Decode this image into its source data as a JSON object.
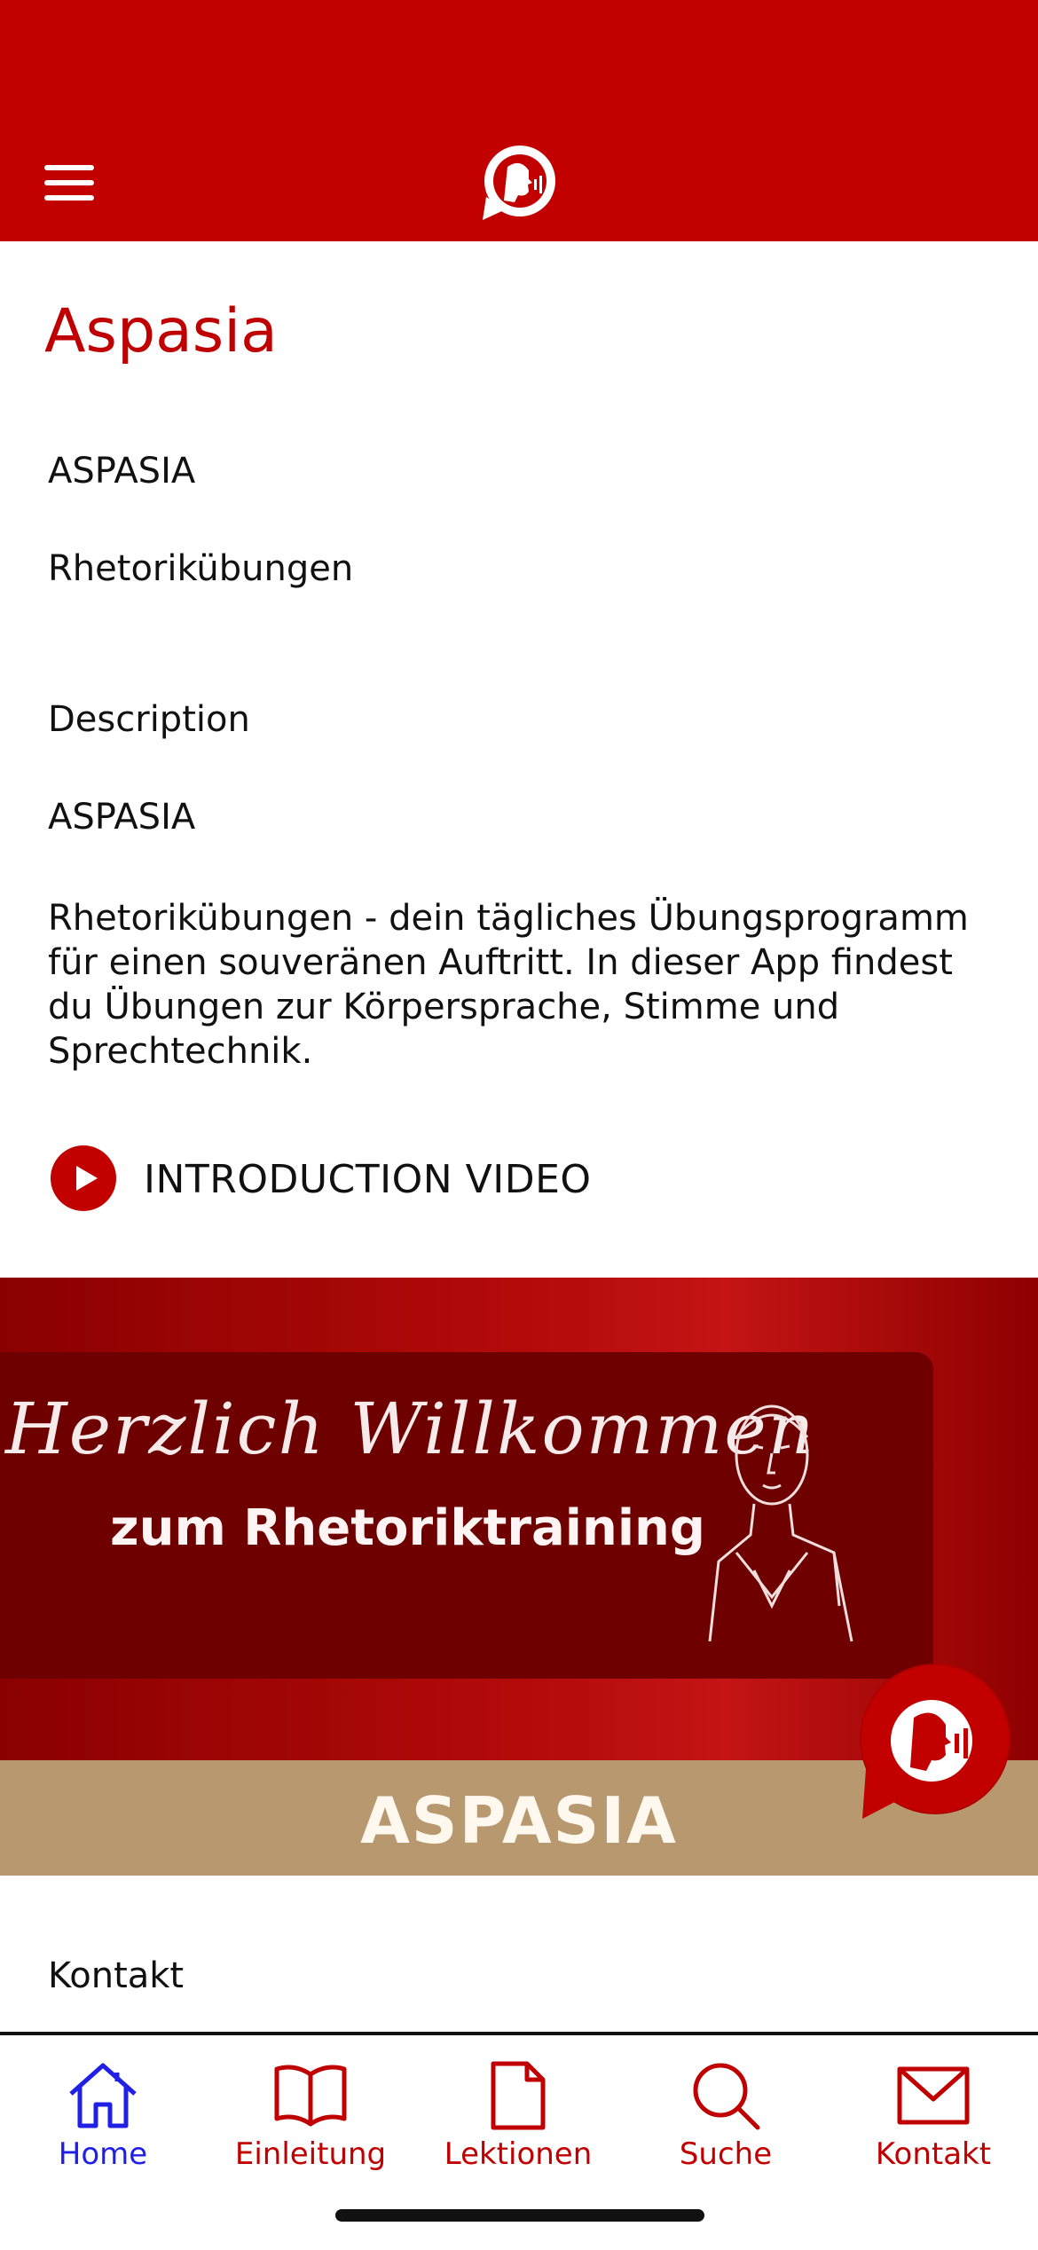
{
  "header": {
    "menu_icon": "menu-icon",
    "logo_icon": "speaking-head-icon"
  },
  "page": {
    "title": "Aspasia",
    "app_name": "ASPASIA",
    "subtitle": "Rhetorikübungen",
    "description_heading": "Description",
    "description_app_name": "ASPASIA",
    "description_text": "Rhetorikübungen - dein tägliches Übungsprogramm für einen souveränen Auftritt. In dieser App findest du Übungen zur Körpersprache, Stimme und Sprechtechnik."
  },
  "video": {
    "label": "INTRODUCTION VIDEO",
    "icon": "play-icon"
  },
  "banner": {
    "script_text": "Herzlich Willkommen",
    "sub_text": "zum Rhetoriktraining",
    "strip_text": "ASPASIA"
  },
  "contact": {
    "label": "Kontakt"
  },
  "tabbar": {
    "items": [
      {
        "label": "Home",
        "icon": "home-icon",
        "active": true
      },
      {
        "label": "Einleitung",
        "icon": "book-icon",
        "active": false
      },
      {
        "label": "Lektionen",
        "icon": "document-icon",
        "active": false
      },
      {
        "label": "Suche",
        "icon": "search-icon",
        "active": false
      },
      {
        "label": "Kontakt",
        "icon": "mail-icon",
        "active": false
      }
    ]
  },
  "colors": {
    "brand_red": "#c20000",
    "active_blue": "#1f1fe6",
    "banner_beige": "#b8996f"
  }
}
